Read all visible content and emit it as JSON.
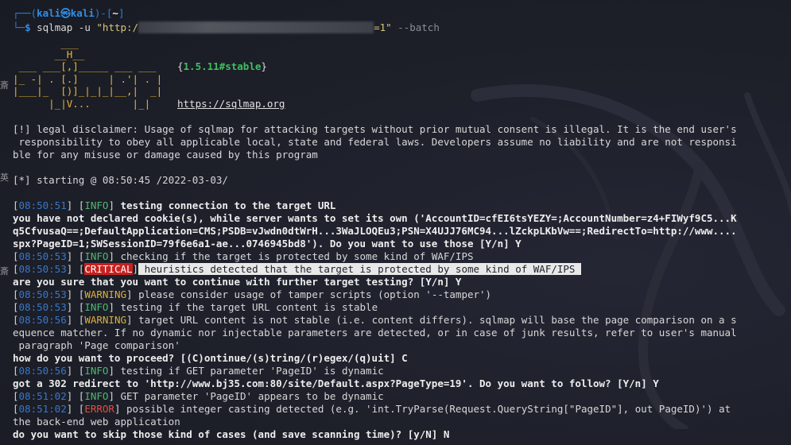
{
  "colors": {
    "background": "#1d1f29",
    "prompt_accent": "#2f8fe8",
    "timestamp": "#3878c8",
    "info": "#4fb870",
    "warning": "#d8b040",
    "error": "#e05040",
    "critical_bg": "#c82020",
    "highlight_bg": "#e8e8e8"
  },
  "gutter": {
    "marks": [
      "斎",
      "英",
      "斎"
    ]
  },
  "prompt": {
    "top_left": "┌──(",
    "user": "kali㉿kali",
    "top_mid": ")-[",
    "path": "~",
    "top_right": "]",
    "bottom": "└─",
    "dollar": "$",
    "command": " sqlmap -u ",
    "url_start": "\"http:/",
    "url_end": "=1\"",
    "option": " --batch"
  },
  "banner": {
    "line1": "        ___",
    "line2": "       __H__",
    "line3": " ___ ___[,]_____ ___ ___  ",
    "line4": "|_ -| . [.]     | .'| . |",
    "line5": "|___|_  [)]_|_|_|__,|  _|",
    "line6": "      |_|V...       |_|   ",
    "version_open": "{",
    "version": "1.5.11#stable",
    "version_close": "}",
    "url": "https://sqlmap.org"
  },
  "disclaimer": [
    "[!] legal disclaimer: Usage of sqlmap for attacking targets without prior mutual consent is illegal. It is the end user's",
    " responsibility to obey all applicable local, state and federal laws. Developers assume no liability and are not responsi",
    "ble for any misuse or damage caused by this program"
  ],
  "starting": "[*] starting @ 08:50:45 /2022-03-03/",
  "log": [
    {
      "time": "08:50:51",
      "level": "INFO",
      "kind": "info",
      "msg": " testing connection to the target URL",
      "bold": true
    },
    {
      "plain": "you have not declared cookie(s), while server wants to set its own ('AccountID=cfEI6tsYEZY=;AccountNumber=z4+FIWyf9C5...K",
      "bold": true
    },
    {
      "plain": "q5CfvusaQ==;DefaultApplication=CMS;PSDB=vJwdn0dtWrH...3WaJLOQEu3;PSN=X4UJJ76MC94...lZckpLKbVw==;RedirectTo=http://www....",
      "bold": true
    },
    {
      "plain": "spx?PageID=1;SWSessionID=79f6e6a1-ae...0746945bd8'). Do you want to use those [Y/n] Y",
      "bold": true
    },
    {
      "time": "08:50:53",
      "level": "INFO",
      "kind": "info",
      "msg": " checking if the target is protected by some kind of WAF/IPS"
    },
    {
      "time": "08:50:53",
      "level": "CRITICAL",
      "kind": "critical",
      "msg": " heuristics detected that the target is protected by some kind of WAF/IPS "
    },
    {
      "plain": "are you sure that you want to continue with further target testing? [Y/n] Y",
      "bold": true
    },
    {
      "time": "08:50:53",
      "level": "WARNING",
      "kind": "warn",
      "msg": " please consider usage of tamper scripts (option '--tamper')"
    },
    {
      "time": "08:50:53",
      "level": "INFO",
      "kind": "info",
      "msg": " testing if the target URL content is stable"
    },
    {
      "time": "08:50:56",
      "level": "WARNING",
      "kind": "warn",
      "msg": " target URL content is not stable (i.e. content differs). sqlmap will base the page comparison on a s"
    },
    {
      "plain": "equence matcher. If no dynamic nor injectable parameters are detected, or in case of junk results, refer to user's manual"
    },
    {
      "plain": " paragraph 'Page comparison'"
    },
    {
      "plain": "how do you want to proceed? [(C)ontinue/(s)tring/(r)egex/(q)uit] C",
      "bold": true
    },
    {
      "time": "08:50:56",
      "level": "INFO",
      "kind": "info",
      "msg": " testing if GET parameter 'PageID' is dynamic"
    },
    {
      "plain": "got a 302 redirect to 'http://www.bj35.com:80/site/Default.aspx?PageType=19'. Do you want to follow? [Y/n] Y",
      "bold": true
    },
    {
      "time": "08:51:02",
      "level": "INFO",
      "kind": "info",
      "msg": " GET parameter 'PageID' appears to be dynamic"
    },
    {
      "time": "08:51:02",
      "level": "ERROR",
      "kind": "err",
      "msg": " possible integer casting detected (e.g. 'int.TryParse(Request.QueryString[\"PageID\"], out PageID)') at"
    },
    {
      "plain": "the back-end web application"
    },
    {
      "plain": "do you want to skip those kind of cases (and save scanning time)? [y/N] N",
      "bold": true
    }
  ]
}
